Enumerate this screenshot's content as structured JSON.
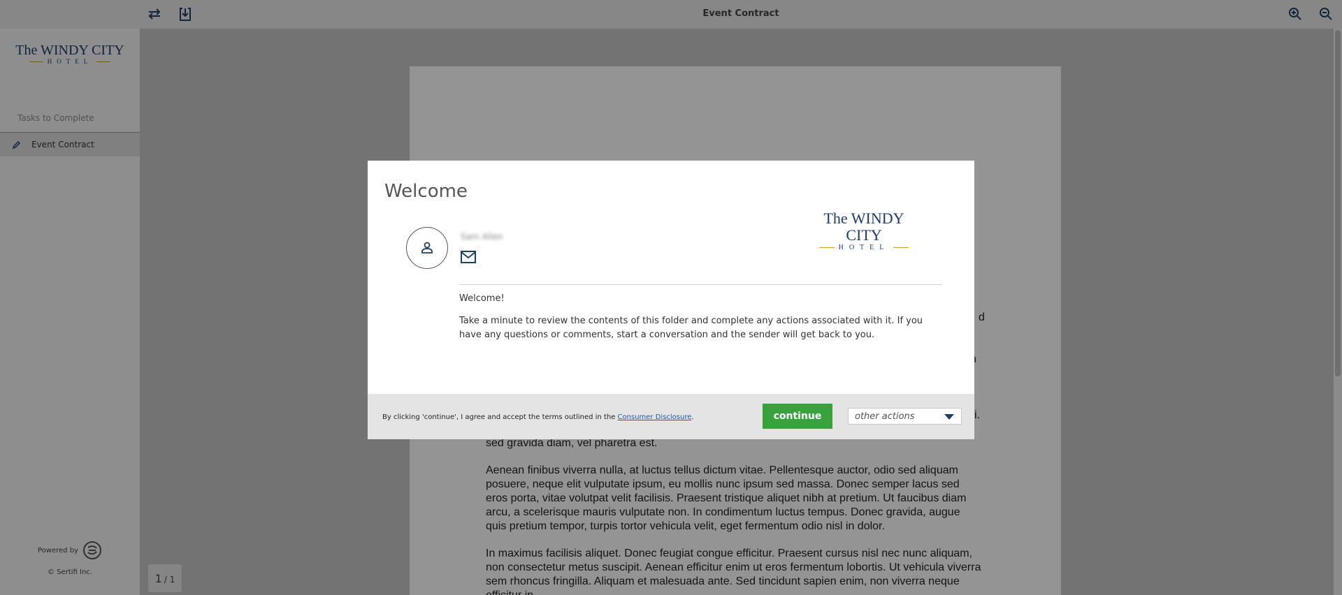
{
  "header": {
    "title": "Event Contract",
    "icons": [
      "swap-icon",
      "download-icon",
      "zoom-in-icon",
      "zoom-out-icon"
    ]
  },
  "sidebar": {
    "logo_main": "The WINDY CITY",
    "logo_sub": "HOTEL",
    "tasks_label": "Tasks to Complete",
    "items": [
      {
        "label": "Event Contract",
        "icon": "pencil-icon"
      }
    ],
    "powered_by": "Powered by",
    "copyright": "© Sertifi Inc."
  },
  "document": {
    "fragments": [
      "d",
      "n",
      "i.",
      "sed gravida diam, vel pharetra est."
    ],
    "paragraphs": [
      "Aenean finibus viverra nulla, at luctus tellus dictum vitae. Pellentesque auctor, odio sed aliquam posuere, neque elit vulputate ipsum, eu mollis nunc ipsum sed massa. Donec semper lacus sed eros porta, vitae volutpat velit facilisis. Praesent tristique aliquet nibh at pretium. Ut faucibus diam arcu, a scelerisque mauris vulputate non. In condimentum luctus tempus. Donec gravida, augue quis pretium tempor, turpis tortor vehicula velit, eget fermentum odio nisl in dolor.",
      "In maximus facilisis aliquet. Donec feugiat congue efficitur. Praesent cursus nisl nec nunc aliquam, non consectetur metus suscipit. Aenean efficitur enim ut eros fermentum lobortis. Ut vehicula viverra sem rhoncus fringilla. Aliquam et malesuada ante. Sed tincidunt sapien enim, non viverra neque efficitur in."
    ],
    "page_current": "1",
    "page_total": "/ 1"
  },
  "modal": {
    "title": "Welcome",
    "logo_main": "The WINDY CITY",
    "logo_sub": "HOTEL",
    "sender_name": "Sam Allen",
    "welcome_heading": "Welcome!",
    "welcome_body": "Take a minute to review the contents of this folder and complete any actions associated with it. If you have any questions or comments, start a conversation and the sender will get back to you.",
    "disclaimer_prefix": "By clicking 'continue', I agree and accept the terms outlined in the ",
    "disclaimer_link": "Consumer Disclosure",
    "disclaimer_suffix": ".",
    "continue_label": "continue",
    "other_actions_label": "other actions"
  },
  "colors": {
    "continue_green": "#3aa23c",
    "brand_navy": "#1f3e66",
    "brand_gold": "#c9a228",
    "link_blue": "#1a5aa8"
  }
}
